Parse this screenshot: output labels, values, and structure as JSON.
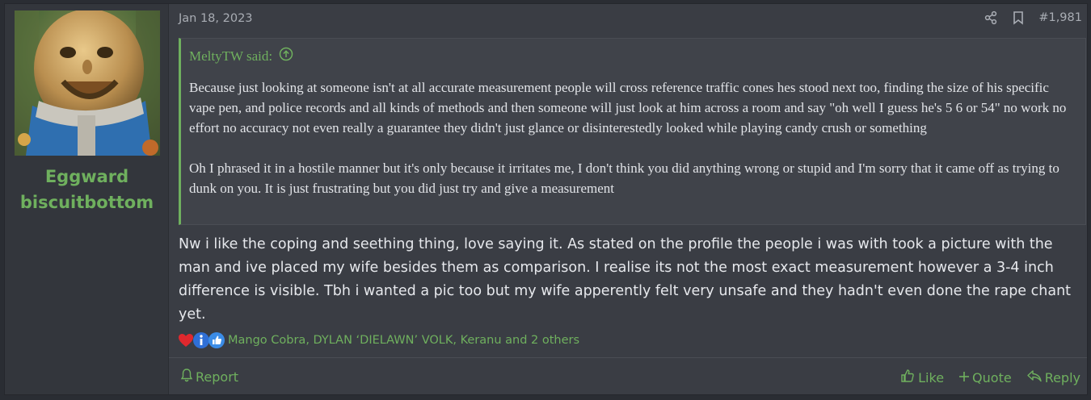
{
  "colors": {
    "accent": "#6fb05e",
    "post_bg": "#3a3d44",
    "user_bg": "#33363c",
    "quote_bg": "#40434a",
    "text": "#e6e8ec",
    "muted": "#a9adb4"
  },
  "user": {
    "name": "Eggward biscuitbottom",
    "avatar_icon": "humpty-dumpty-avatar"
  },
  "post": {
    "date": "Jan 18, 2023",
    "number": "#1,981",
    "share_icon": "share-icon",
    "bookmark_icon": "bookmark-icon"
  },
  "quote": {
    "author": "MeltyTW said:",
    "paragraphs": [
      "Because just looking at someone isn't at all accurate measurement people will cross reference traffic cones hes stood next too, finding the size of his specific vape pen, and police records and all kinds of methods and then someone will just look at him across a room and say \"oh well I guess he's 5 6 or 54\" no work no effort no accuracy not even really a guarantee they didn't just glance or disinterestedly looked while playing candy crush or something",
      "Oh I phrased it in a hostile manner but it's only because it irritates me, I don't think you did anything wrong or stupid and I'm sorry that it came off as trying to dunk on you. It is just frustrating but you did just try and give a measurement"
    ]
  },
  "message": "Nw i like the coping and seething thing, love saying it. As stated on the profile the people i was with took a picture with the man and ive placed my wife besides them as comparison. I realise its not the most exact measurement however a 3-4 inch difference is visible. Tbh i wanted a pic too but my wife apperently felt very unsafe and they hadn't even done the rape chant yet.",
  "reactions": {
    "icons": [
      "heart-icon",
      "info-icon",
      "thumbs-up-icon"
    ],
    "users": "Mango Cobra, DYLAN ‘DIELAWN’ VOLK, Keranu and 2 others"
  },
  "footer": {
    "report": "Report",
    "like": "Like",
    "quote": "Quote",
    "reply": "Reply"
  }
}
